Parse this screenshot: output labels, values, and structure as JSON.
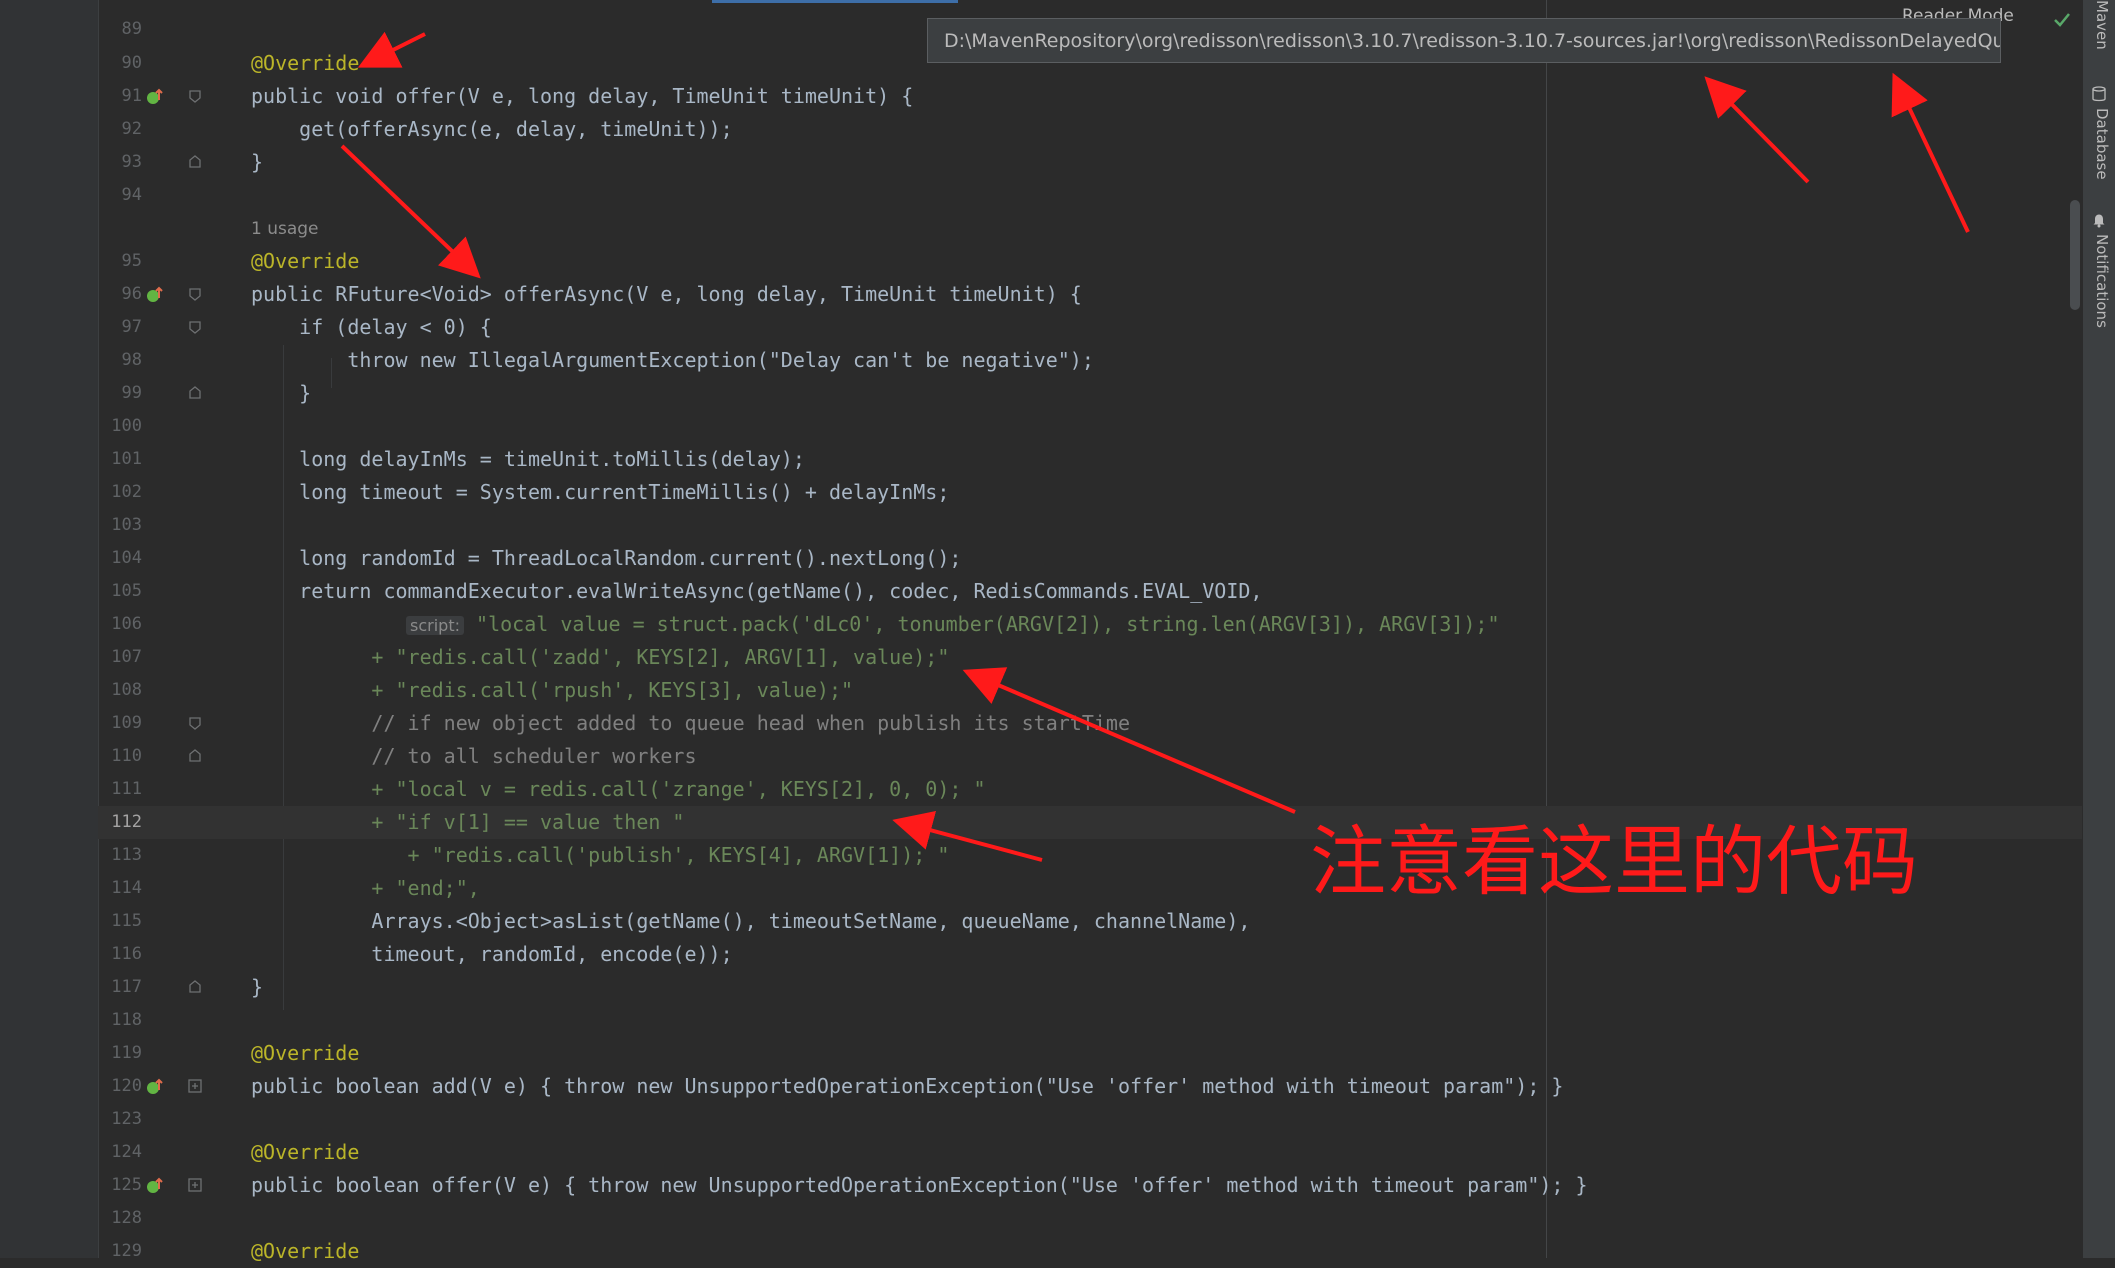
{
  "tooltip": {
    "path": "D:\\MavenRepository\\org\\redisson\\redisson\\3.10.7\\redisson-3.10.7-sources.jar!\\org\\redisson\\RedissonDelayedQueue.java"
  },
  "reader_mode": "Reader Mode",
  "right_tabs": {
    "maven": "Maven",
    "database": "Database",
    "notifications": "Notifications"
  },
  "usage_hint": "1 usage",
  "param_hint": "script:",
  "annotation": "注意看这里的代码",
  "line_numbers": {
    "l89": "89",
    "l90": "90",
    "l91": "91",
    "l92": "92",
    "l93": "93",
    "l94": "94",
    "l95": "95",
    "l96": "96",
    "l97": "97",
    "l98": "98",
    "l99": "99",
    "l100": "100",
    "l101": "101",
    "l102": "102",
    "l103": "103",
    "l104": "104",
    "l105": "105",
    "l106": "106",
    "l107": "107",
    "l108": "108",
    "l109": "109",
    "l110": "110",
    "l111": "111",
    "l112": "112",
    "l113": "113",
    "l114": "114",
    "l115": "115",
    "l116": "116",
    "l117": "117",
    "l118": "118",
    "l119": "119",
    "l120": "120",
    "l123": "123",
    "l124": "124",
    "l125": "125",
    "l128": "128",
    "l129": "129"
  },
  "code": {
    "c90": "@Override",
    "c91": "public void offer(V e, long delay, TimeUnit timeUnit) {",
    "c92": "    get(offerAsync(e, delay, timeUnit));",
    "c93": "}",
    "c95": "@Override",
    "c96": "public RFuture<Void> offerAsync(V e, long delay, TimeUnit timeUnit) {",
    "c97": "    if (delay < 0) {",
    "c98": "        throw new IllegalArgumentException(\"Delay can't be negative\");",
    "c99": "    }",
    "c101": "    long delayInMs = timeUnit.toMillis(delay);",
    "c102": "    long timeout = System.currentTimeMillis() + delayInMs;",
    "c104": "    long randomId = ThreadLocalRandom.current().nextLong();",
    "c105": "    return commandExecutor.evalWriteAsync(getName(), codec, RedisCommands.EVAL_VOID,",
    "c106": "\"local value = struct.pack('dLc0', tonumber(ARGV[2]), string.len(ARGV[3]), ARGV[3]);\"",
    "c107": "          + \"redis.call('zadd', KEYS[2], ARGV[1], value);\"",
    "c108": "          + \"redis.call('rpush', KEYS[3], value);\"",
    "c109": "          // if new object added to queue head when publish its startTime",
    "c110": "          // to all scheduler workers",
    "c111": "          + \"local v = redis.call('zrange', KEYS[2], 0, 0); \"",
    "c112": "          + \"if v[1] == value then \"",
    "c113": "             + \"redis.call('publish', KEYS[4], ARGV[1]); \"",
    "c114": "          + \"end;\",",
    "c115": "          Arrays.<Object>asList(getName(), timeoutSetName, queueName, channelName),",
    "c116": "          timeout, randomId, encode(e));",
    "c117": "}",
    "c119": "@Override",
    "c120": "public boolean add(V e) { throw new UnsupportedOperationException(\"Use 'offer' method with timeout param\"); }",
    "c124": "@Override",
    "c125": "public boolean offer(V e) { throw new UnsupportedOperationException(\"Use 'offer' method with timeout param\"); }",
    "c129": "@Override"
  },
  "colors": {
    "keyword": "#cc7832",
    "annotation": "#bbb529",
    "function": "#ffc66d",
    "string": "#6a8759",
    "number": "#6897bb",
    "field": "#9876aa",
    "comment": "#808080",
    "arrow": "#ff1a1a"
  }
}
